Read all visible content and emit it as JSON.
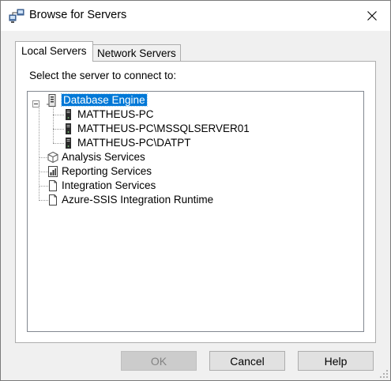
{
  "window": {
    "title": "Browse for Servers"
  },
  "tabs": [
    {
      "label": "Local Servers",
      "active": true
    },
    {
      "label": "Network Servers",
      "active": false
    }
  ],
  "panel": {
    "prompt": "Select the server to connect to:"
  },
  "tree": {
    "root": {
      "label": "Database Engine",
      "selected": true,
      "expanded": true
    },
    "servers": [
      {
        "label": "MATTHEUS-PC"
      },
      {
        "label": "MATTHEUS-PC\\MSSQLSERVER01"
      },
      {
        "label": "MATTHEUS-PC\\DATPT"
      }
    ],
    "services": [
      {
        "label": "Analysis Services",
        "icon": "cube-icon"
      },
      {
        "label": "Reporting Services",
        "icon": "report-icon"
      },
      {
        "label": "Integration Services",
        "icon": "document-icon"
      },
      {
        "label": "Azure-SSIS Integration Runtime",
        "icon": "document-icon"
      }
    ]
  },
  "buttons": {
    "ok": {
      "label": "OK",
      "enabled": false
    },
    "cancel": {
      "label": "Cancel"
    },
    "help": {
      "label": "Help"
    }
  },
  "colors": {
    "selection": "#0078d7",
    "disabled_button": "#cccccc",
    "button": "#e1e1e1"
  }
}
